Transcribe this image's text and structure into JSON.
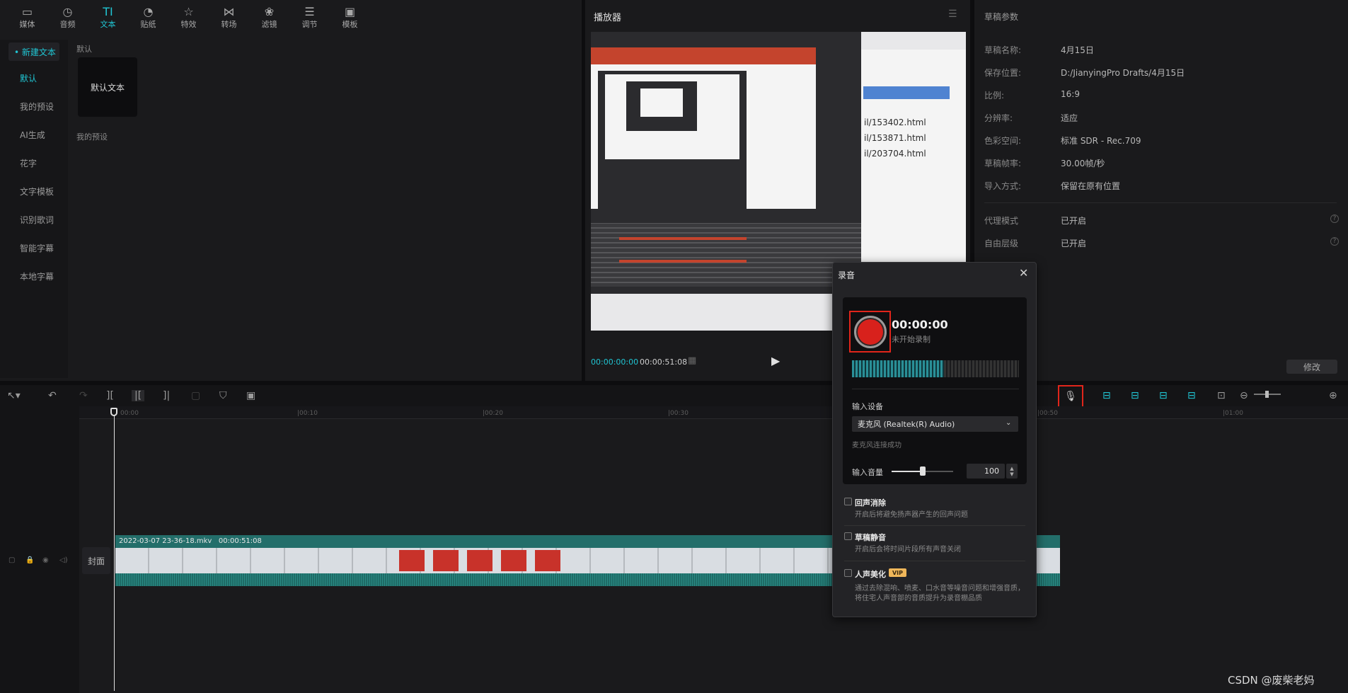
{
  "toolbar": {
    "items": [
      {
        "label": "媒体",
        "icon": "media-icon"
      },
      {
        "label": "音频",
        "icon": "audio-icon"
      },
      {
        "label": "文本",
        "icon": "text-icon",
        "active": true
      },
      {
        "label": "贴纸",
        "icon": "sticker-icon"
      },
      {
        "label": "特效",
        "icon": "effects-icon"
      },
      {
        "label": "转场",
        "icon": "transition-icon"
      },
      {
        "label": "滤镜",
        "icon": "filter-icon"
      },
      {
        "label": "调节",
        "icon": "adjust-icon"
      },
      {
        "label": "模板",
        "icon": "template-icon"
      }
    ]
  },
  "side_nav": {
    "head": "• 新建文本",
    "items": [
      "默认",
      "我的预设",
      "AI生成",
      "花字",
      "文字模板",
      "识别歌词",
      "智能字幕",
      "本地字幕"
    ]
  },
  "content": {
    "section_default": "默认",
    "card_label": "默认文本",
    "section_presets": "我的预设"
  },
  "player": {
    "title": "播放器",
    "time_current": "00:00:00:00",
    "time_total": "00:00:51:08",
    "urls": [
      "il/153402.html",
      "il/153871.html",
      "il/203704.html"
    ]
  },
  "props": {
    "title": "草稿参数",
    "rows": [
      {
        "label": "草稿名称:",
        "value": "4月15日"
      },
      {
        "label": "保存位置:",
        "value": "D:/JianyingPro Drafts/4月15日"
      },
      {
        "label": "比例:",
        "value": "16:9"
      },
      {
        "label": "分辨率:",
        "value": "适应"
      },
      {
        "label": "色彩空间:",
        "value": "标准 SDR - Rec.709"
      },
      {
        "label": "草稿帧率:",
        "value": "30.00帧/秒"
      },
      {
        "label": "导入方式:",
        "value": "保留在原有位置"
      }
    ],
    "rows2": [
      {
        "label": "代理模式",
        "value": "已开启"
      },
      {
        "label": "自由层级",
        "value": "已开启"
      }
    ],
    "modify_label": "修改"
  },
  "timeline": {
    "ticks": [
      "00:00",
      "|00:10",
      "|00:20",
      "|00:30",
      "|00:50",
      "|01:00"
    ],
    "clip_name": "2022-03-07 23-36-18.mkv",
    "clip_duration": "00:00:51:08",
    "cover_label": "封面"
  },
  "recording": {
    "title": "录音",
    "time": "00:00:00",
    "status": "未开始录制",
    "meter_level": 0.55,
    "device_label": "输入设备",
    "device_value": "麦克风 (Realtek(R) Audio)",
    "device_status": "麦克风连接成功",
    "volume_label": "输入音量",
    "volume_value": "100",
    "volume_level": 0.5,
    "options": [
      {
        "title": "回声消除",
        "desc": "开启后将避免扬声器产生的回声问题"
      },
      {
        "title": "草稿静音",
        "desc": "开启后会将时间片段所有声音关闭"
      },
      {
        "title": "人声美化",
        "desc": "通过去除混响、喷麦、口水音等噪音问题和增强音质，将住宅人声音部的音质提升为录音棚品质"
      }
    ],
    "vip_label": "VIP"
  },
  "watermark": "CSDN @废柴老妈",
  "colors": {
    "accent": "#20c5d3",
    "record_red": "#d8211c",
    "highlight_frame": "#e1251b"
  }
}
